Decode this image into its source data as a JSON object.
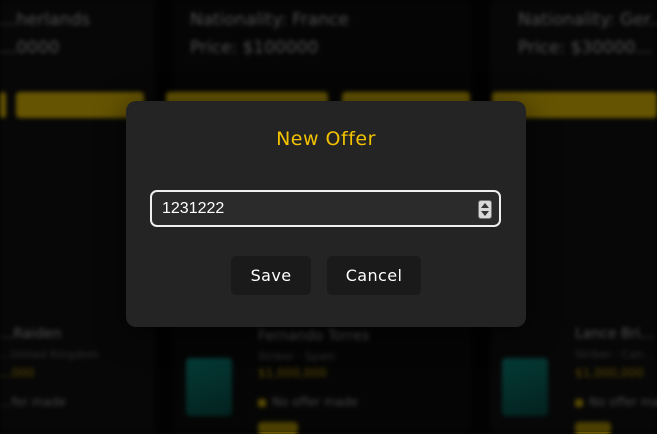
{
  "background": {
    "cards": [
      {
        "nationality": "...herlands",
        "price": "...0000"
      },
      {
        "nationality": "Nationality: France",
        "price": "Price: $100000"
      },
      {
        "nationality": "Nationality: Ger...",
        "price": "Price: $30000..."
      }
    ],
    "players": [
      {
        "name": "...Raiden",
        "sub": "...United Kingdom",
        "price": "...000",
        "offer": "...fer made"
      },
      {
        "name": "Fernando Torres",
        "sub": "Striker · Spain",
        "price": "$1,000,000",
        "offer": "No offer made"
      },
      {
        "name": "Lance Bri...",
        "sub": "Striker · Can...",
        "price": "$1,000,000",
        "offer": "No offer made"
      }
    ]
  },
  "modal": {
    "title": "New Offer",
    "offer_value": "1231222",
    "save_label": "Save",
    "cancel_label": "Cancel"
  },
  "colors": {
    "accent": "#f2c200",
    "modal_bg": "#242424",
    "button_bg": "#1a1a1a"
  }
}
